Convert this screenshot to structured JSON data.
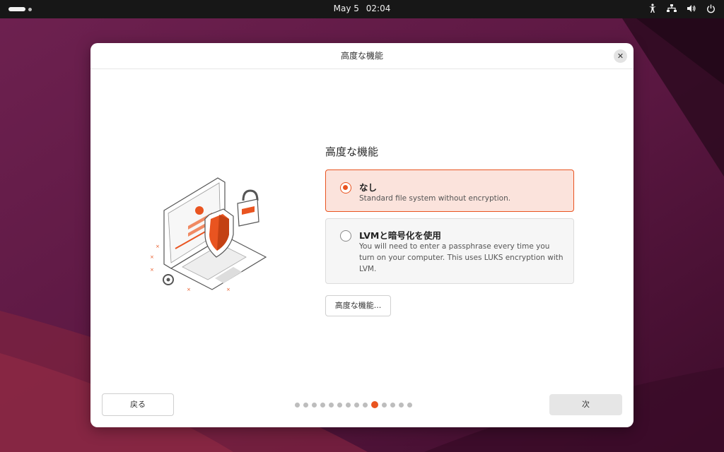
{
  "topbar": {
    "date": "May 5",
    "time": "02:04",
    "tray_icons": [
      "accessibility-icon",
      "network-icon",
      "volume-icon",
      "power-icon"
    ]
  },
  "dialog": {
    "title": "高度な機能",
    "close_label": "✕"
  },
  "content": {
    "heading": "高度な機能",
    "options": [
      {
        "title": "なし",
        "description": "Standard file system without encryption.",
        "selected": true
      },
      {
        "title": "LVMと暗号化を使用",
        "description": "You will need to enter a passphrase every time you turn on your computer. This uses LUKS encryption with LVM.",
        "selected": false
      }
    ],
    "advanced_button": "高度な機能..."
  },
  "footer": {
    "back_label": "戻る",
    "next_label": "次",
    "page_count": 14,
    "current_page": 10
  },
  "colors": {
    "accent": "#e95420",
    "selected_bg": "#fbe3dc",
    "topbar": "#171717"
  }
}
